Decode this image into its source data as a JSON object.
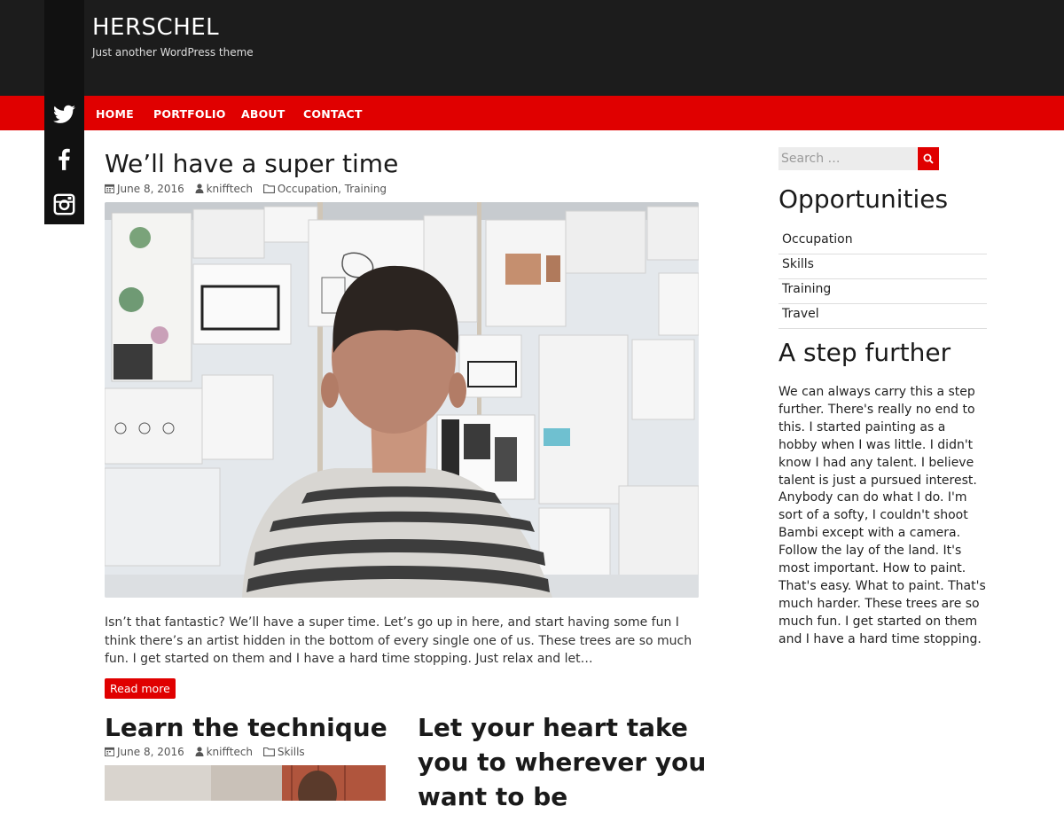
{
  "site": {
    "title": "HERSCHEL",
    "tagline": "Just another WordPress theme"
  },
  "nav": {
    "items": [
      "HOME",
      "PORTFOLIO",
      "ABOUT",
      "CONTACT"
    ]
  },
  "social": [
    "twitter-icon",
    "facebook-icon",
    "instagram-icon"
  ],
  "colors": {
    "accent": "#e00000",
    "header_bg": "#1c1c1c",
    "social_bg": "#111111"
  },
  "featured_post": {
    "title": "We’ll have a super time",
    "date": "June 8, 2016",
    "author": "knifftech",
    "categories": [
      "Occupation",
      "Training"
    ],
    "excerpt": "Isn’t that fantastic? We’ll have a super time. Let’s go up in here, and start having some fun I think there’s an artist hidden in the bottom of every single one of us. These trees are so much fun. I get started on them and I have a hard time stopping. Just relax and let…",
    "read_more": "Read more"
  },
  "posts": [
    {
      "title": "Learn the technique",
      "date": "June 8, 2016",
      "author": "knifftech",
      "categories": [
        "Skills"
      ]
    },
    {
      "title": "Let your heart take you to wherever you want to be"
    }
  ],
  "sidebar": {
    "search_placeholder": "Search …",
    "categories_title": "Opportunities",
    "categories": [
      "Occupation",
      "Skills",
      "Training",
      "Travel"
    ],
    "text_title": "A step further",
    "text_body": "We can always carry this a step further. There's really no end to this. I started painting as a hobby when I was little. I didn't know I had any talent. I believe talent is just a pursued interest. Anybody can do what I do. I'm sort of a softy, I couldn't shoot Bambi except with a camera. Follow the lay of the land. It's most important. How to paint. That's easy. What to paint. That's much harder. These trees are so much fun. I get started on them and I have a hard time stopping."
  }
}
